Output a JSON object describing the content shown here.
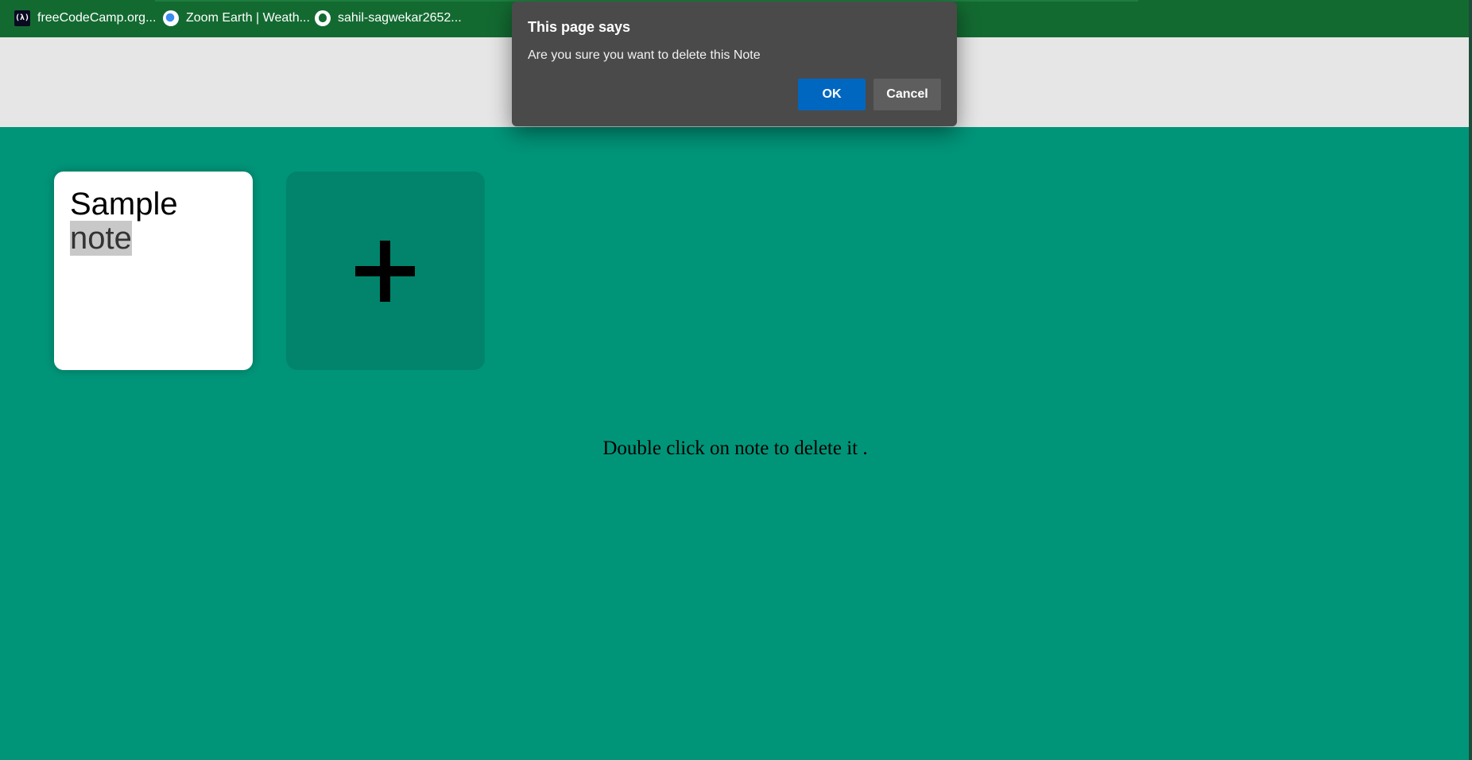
{
  "bookmarks": [
    {
      "label": "freeCodeCamp.org...",
      "icon": "freecodecamp-icon",
      "icon_text": "(λ)"
    },
    {
      "label": "Zoom Earth | Weath...",
      "icon": "zoom-earth-icon"
    },
    {
      "label": "sahil-sagwekar2652...",
      "icon": "github-icon"
    }
  ],
  "note": {
    "line1": "Sample",
    "line2": "note"
  },
  "add_button": {
    "icon": "plus-icon"
  },
  "hint": "Double click on note to delete it .",
  "dialog": {
    "title": "This page says",
    "message": "Are you sure you want to delete this Note",
    "ok_label": "OK",
    "cancel_label": "Cancel"
  },
  "colors": {
    "page_background": "#009579",
    "bookmarks_bar": "#136a31",
    "header_band": "#e6e6e6",
    "add_note_tile": "#01846b",
    "dialog_background": "#4a4a4a",
    "ok_button": "#0067c0",
    "cancel_button": "#5e5e5e"
  }
}
